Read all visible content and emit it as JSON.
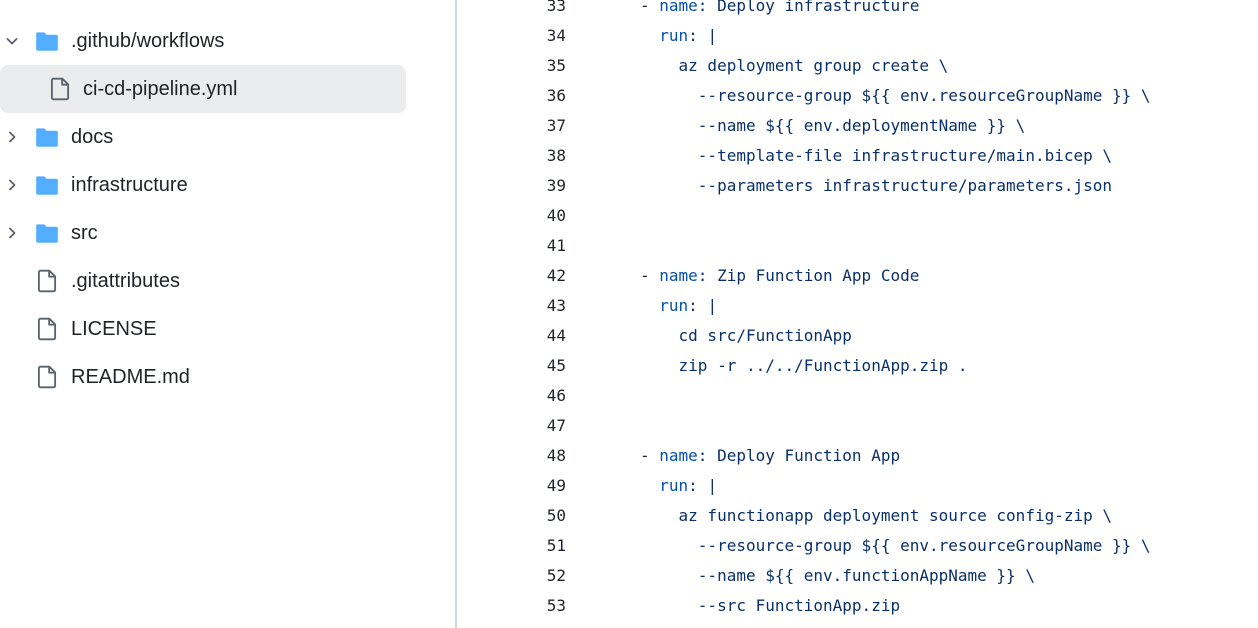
{
  "file_tree": {
    "items": [
      {
        "name": ".github/workflows",
        "type": "folder",
        "expanded": true,
        "depth": 0
      },
      {
        "name": "ci-cd-pipeline.yml",
        "type": "file",
        "selected": true,
        "depth": 1
      },
      {
        "name": "docs",
        "type": "folder",
        "expanded": false,
        "depth": 0
      },
      {
        "name": "infrastructure",
        "type": "folder",
        "expanded": false,
        "depth": 0
      },
      {
        "name": "src",
        "type": "folder",
        "expanded": false,
        "depth": 0
      },
      {
        "name": ".gitattributes",
        "type": "file",
        "depth": 0
      },
      {
        "name": "LICENSE",
        "type": "file",
        "depth": 0
      },
      {
        "name": "README.md",
        "type": "file",
        "depth": 0
      }
    ]
  },
  "code": {
    "lines": [
      {
        "n": "33",
        "indent": "",
        "key": "- name",
        "rest": ": Deploy infrastructure"
      },
      {
        "n": "34",
        "indent": "  ",
        "key": "run",
        "rest": ": |"
      },
      {
        "n": "35",
        "indent": "    ",
        "key": "",
        "rest": "az deployment group create \\"
      },
      {
        "n": "36",
        "indent": "      ",
        "key": "",
        "rest": "--resource-group ${{ env.resourceGroupName }} \\"
      },
      {
        "n": "37",
        "indent": "      ",
        "key": "",
        "rest": "--name ${{ env.deploymentName }} \\"
      },
      {
        "n": "38",
        "indent": "      ",
        "key": "",
        "rest": "--template-file infrastructure/main.bicep \\"
      },
      {
        "n": "39",
        "indent": "      ",
        "key": "",
        "rest": "--parameters infrastructure/parameters.json"
      },
      {
        "n": "40",
        "indent": "",
        "key": "",
        "rest": ""
      },
      {
        "n": "41",
        "indent": "",
        "key": "",
        "rest": ""
      },
      {
        "n": "42",
        "indent": "",
        "key": "- name",
        "rest": ": Zip Function App Code"
      },
      {
        "n": "43",
        "indent": "  ",
        "key": "run",
        "rest": ": |"
      },
      {
        "n": "44",
        "indent": "    ",
        "key": "",
        "rest": "cd src/FunctionApp"
      },
      {
        "n": "45",
        "indent": "    ",
        "key": "",
        "rest": "zip -r ../../FunctionApp.zip ."
      },
      {
        "n": "46",
        "indent": "",
        "key": "",
        "rest": ""
      },
      {
        "n": "47",
        "indent": "",
        "key": "",
        "rest": ""
      },
      {
        "n": "48",
        "indent": "",
        "key": "- name",
        "rest": ": Deploy Function App"
      },
      {
        "n": "49",
        "indent": "  ",
        "key": "run",
        "rest": ": |"
      },
      {
        "n": "50",
        "indent": "    ",
        "key": "",
        "rest": "az functionapp deployment source config-zip \\"
      },
      {
        "n": "51",
        "indent": "      ",
        "key": "",
        "rest": "--resource-group ${{ env.resourceGroupName }} \\"
      },
      {
        "n": "52",
        "indent": "      ",
        "key": "",
        "rest": "--name ${{ env.functionAppName }} \\"
      },
      {
        "n": "53",
        "indent": "      ",
        "key": "",
        "rest": "--src FunctionApp.zip"
      }
    ]
  },
  "colors": {
    "folder": "#54aeff",
    "file_icon": "#59636e",
    "selected_bg": "#eaecee",
    "yaml_key": "#0550ae",
    "text": "#1f2328"
  }
}
